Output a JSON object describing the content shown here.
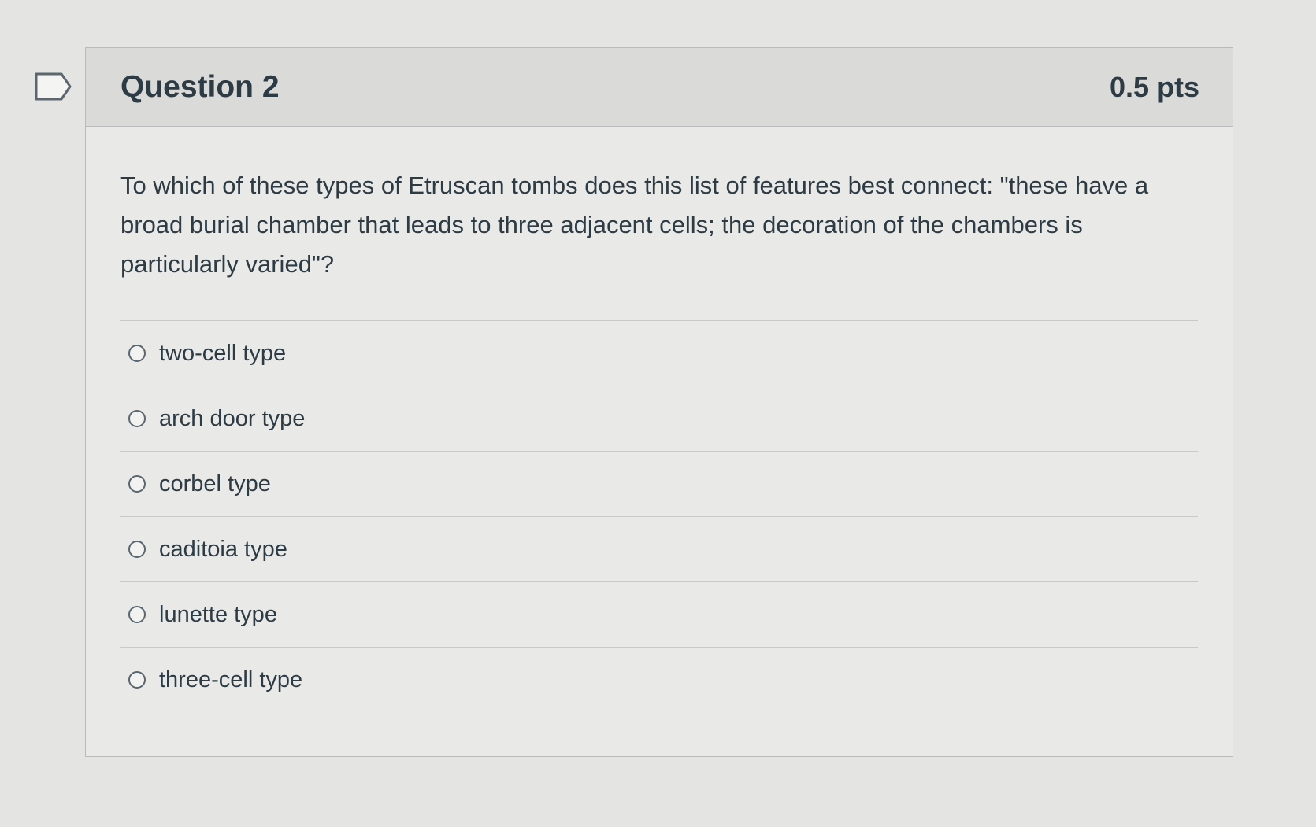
{
  "question": {
    "title": "Question 2",
    "points": "0.5 pts",
    "flag_icon": "flag-outline-icon",
    "text": "To which of these types of Etruscan tombs does this list of features best connect: \"these have a broad burial chamber that leads to three adjacent cells; the decoration of the chambers is particularly varied\"?",
    "answers": [
      {
        "label": "two-cell type",
        "selected": false
      },
      {
        "label": "arch door type",
        "selected": false
      },
      {
        "label": "corbel type",
        "selected": false
      },
      {
        "label": "caditoia type",
        "selected": false
      },
      {
        "label": "lunette type",
        "selected": false
      },
      {
        "label": "three-cell type",
        "selected": false
      }
    ]
  },
  "colors": {
    "background": "#e4e4e2",
    "header_background": "#dadbd9",
    "text": "#2d3b45",
    "border": "#b9bcbd"
  }
}
